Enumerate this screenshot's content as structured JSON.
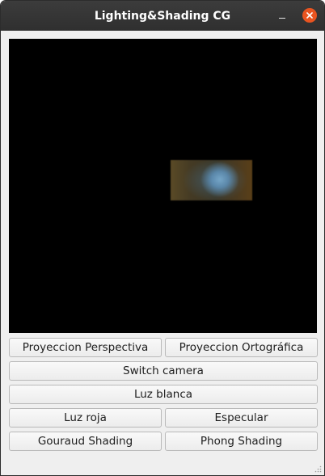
{
  "window": {
    "title": "Lighting&Shading CG",
    "close_color": "#e95420"
  },
  "titlebar_icons": [
    "minimize-icon",
    "close-icon"
  ],
  "viewport": {
    "background": "#000000",
    "content": "rendered-sphere-quad"
  },
  "buttons": {
    "perspective": "Proyeccion Perspectiva",
    "orthographic": "Proyeccion Ortográfica",
    "switch_camera": "Switch camera",
    "white_light": "Luz blanca",
    "red_light": "Luz roja",
    "specular": "Especular",
    "gouraud": "Gouraud Shading",
    "phong": "Phong Shading"
  }
}
